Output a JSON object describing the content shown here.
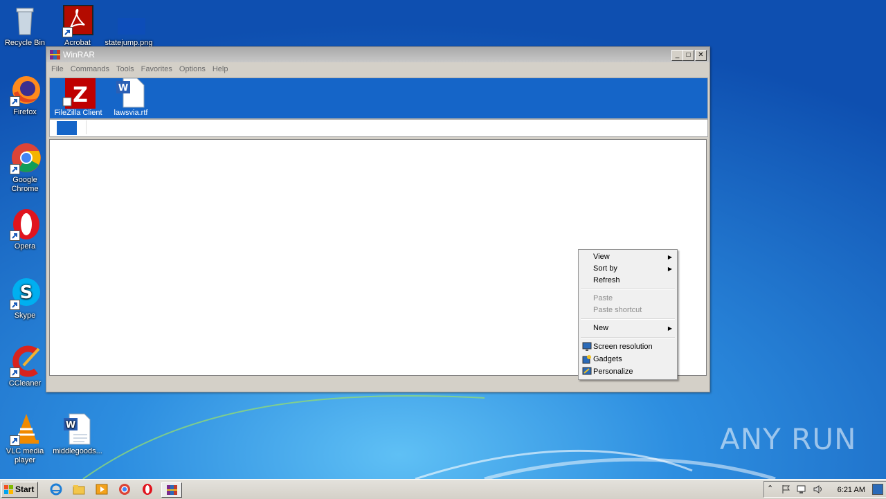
{
  "desktop": {
    "icons": {
      "recycle_bin": "Recycle Bin",
      "acrobat": "Acrobat",
      "statejump": "statejump.png",
      "firefox": "Firefox",
      "chrome": "Google Chrome",
      "opera": "Opera",
      "skype": "Skype",
      "ccleaner": "CCleaner",
      "vlc": "VLC media player",
      "middlegoods": "middlegoods..."
    }
  },
  "window": {
    "title": "WinRAR",
    "menu": [
      "File",
      "Commands",
      "Tools",
      "Favorites",
      "Options",
      "Help"
    ],
    "toolbar_icons": {
      "filezilla": "FileZilla Client",
      "lawsvia": "lawsvia.rtf"
    }
  },
  "context_menu": {
    "view": "View",
    "sort_by": "Sort by",
    "refresh": "Refresh",
    "paste": "Paste",
    "paste_shortcut": "Paste shortcut",
    "new": "New",
    "screen_resolution": "Screen resolution",
    "gadgets": "Gadgets",
    "personalize": "Personalize"
  },
  "taskbar": {
    "start_label": "Start",
    "clock": "6:21 AM"
  },
  "watermark": "ANY RUN",
  "colors": {
    "desktop_bg": "#1e68c8",
    "window_frame": "#d4d0c8",
    "toolbar_bg": "#1565c8"
  }
}
